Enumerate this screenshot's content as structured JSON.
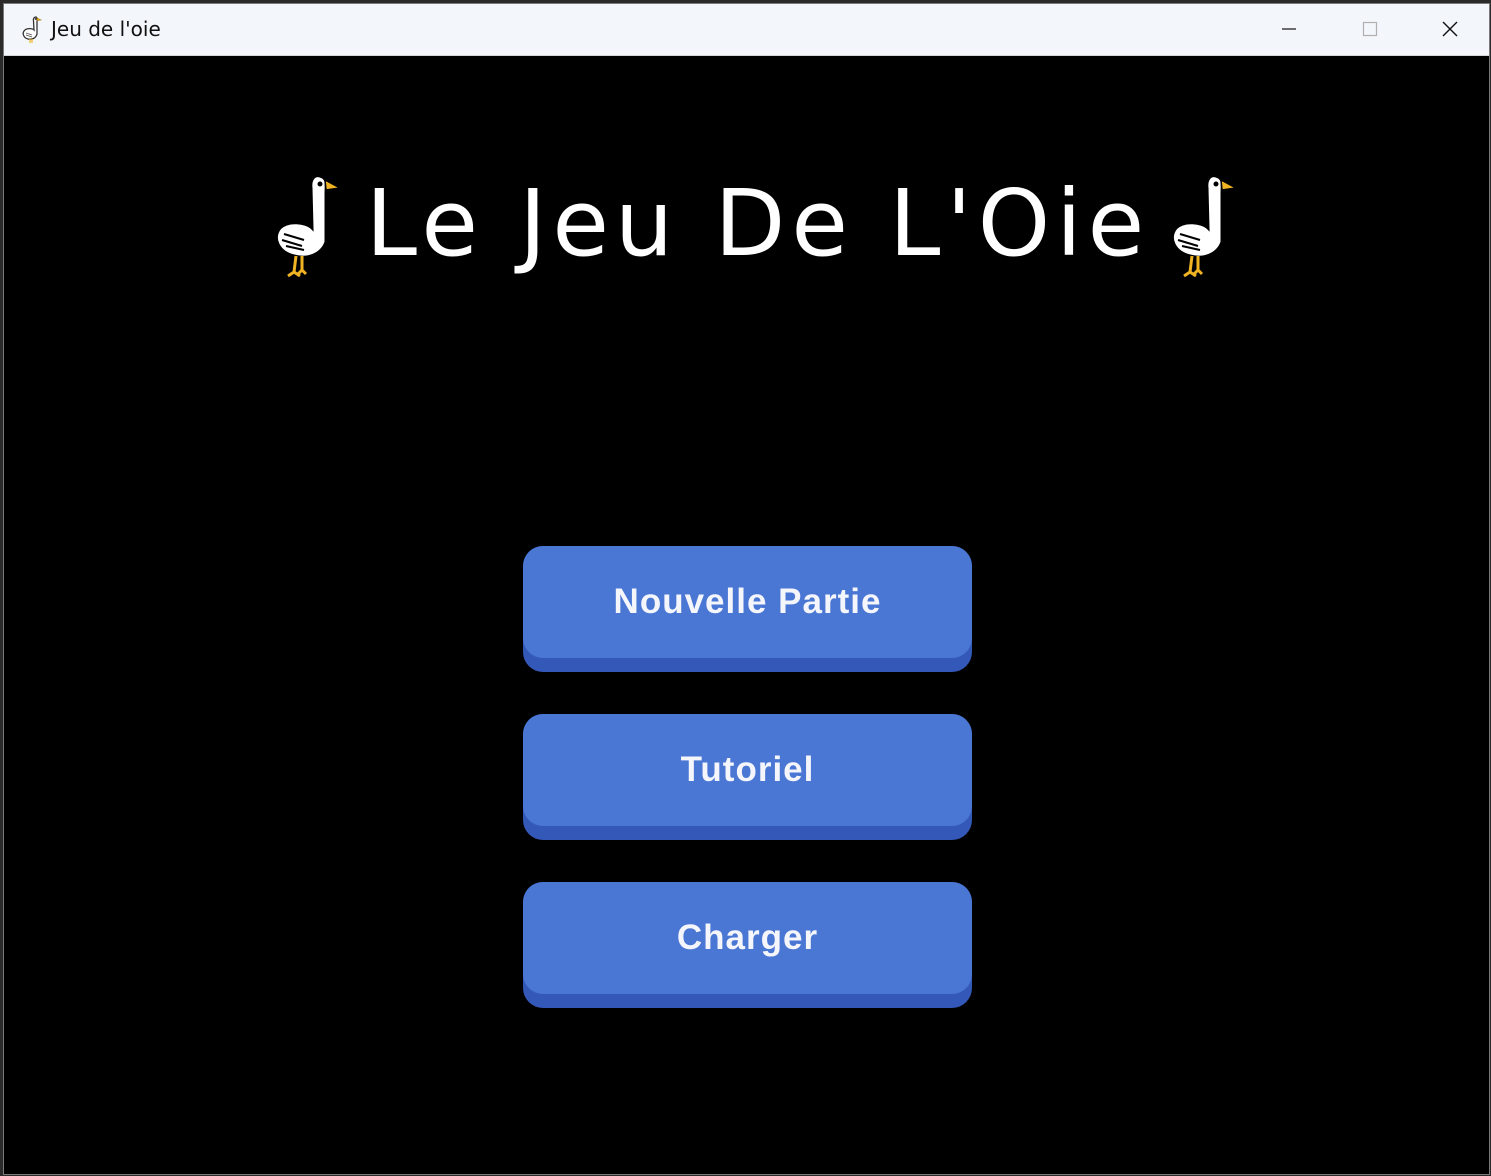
{
  "window": {
    "title": "Jeu de l'oie",
    "app_icon": "goose-icon",
    "controls": [
      "minimize-icon",
      "maximize-icon",
      "close-icon"
    ]
  },
  "game": {
    "heading": "Le Jeu De L'Oie",
    "heading_icons": [
      "goose-icon",
      "goose-icon"
    ],
    "menu": [
      {
        "id": "new-game",
        "label": "Nouvelle Partie"
      },
      {
        "id": "tutorial",
        "label": "Tutoriel"
      },
      {
        "id": "load",
        "label": "Charger"
      }
    ]
  },
  "colors": {
    "background": "#000000",
    "button_face": "#4a76d4",
    "button_shadow": "#3358b8",
    "button_text": "#f4f6fb",
    "heading_text": "#ffffff",
    "goose_beak": "#f0b323"
  }
}
